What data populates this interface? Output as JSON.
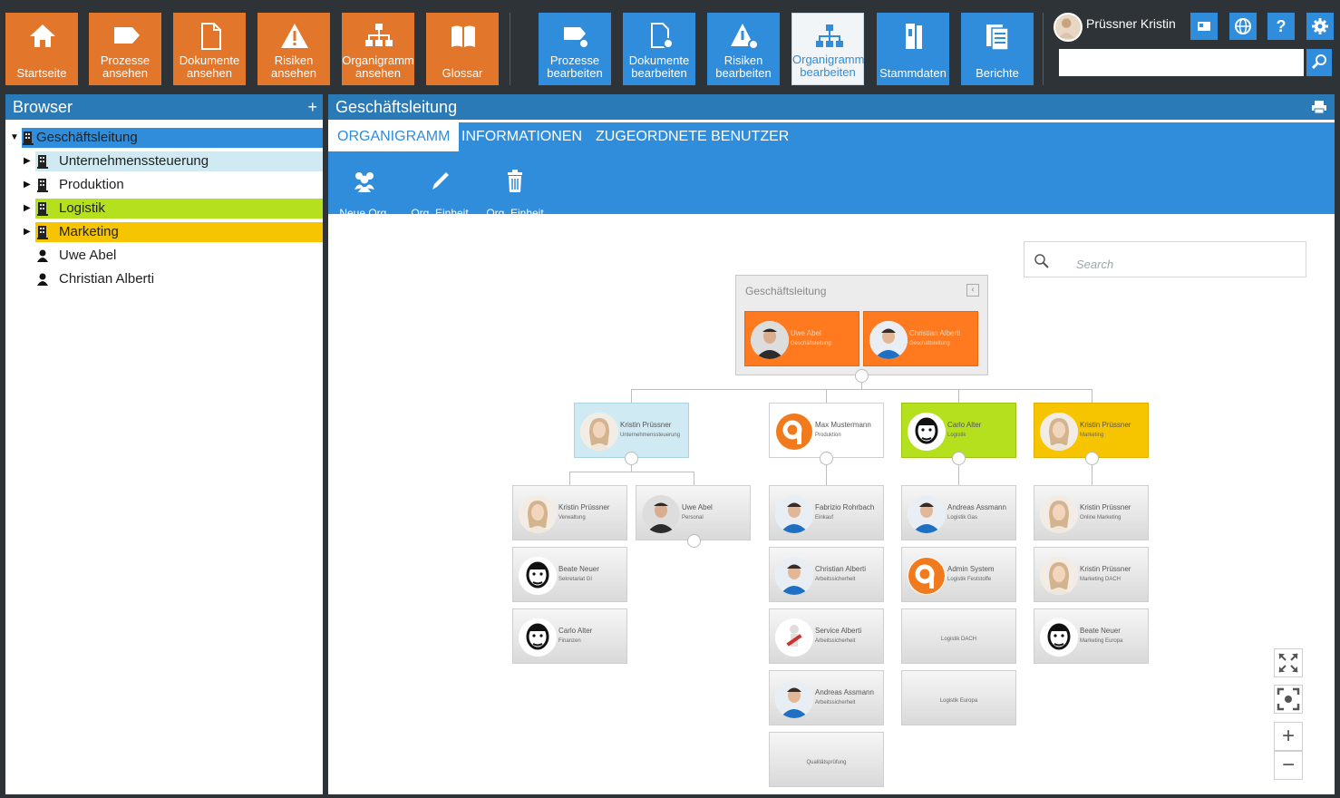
{
  "toolbar": {
    "view_buttons": [
      {
        "label": "Startseite",
        "icon": "home-icon"
      },
      {
        "label": "Prozesse\nansehen",
        "icon": "process-icon"
      },
      {
        "label": "Dokumente\nansehen",
        "icon": "document-icon"
      },
      {
        "label": "Risiken\nansehen",
        "icon": "warning-icon"
      },
      {
        "label": "Organigramm\nansehen",
        "icon": "orgchart-icon"
      },
      {
        "label": "Glossar",
        "icon": "book-icon"
      }
    ],
    "edit_buttons": [
      {
        "label": "Prozesse\nbearbeiten",
        "icon": "process-gear-icon"
      },
      {
        "label": "Dokumente\nbearbeiten",
        "icon": "document-gear-icon"
      },
      {
        "label": "Risiken\nbearbeiten",
        "icon": "warning-gear-icon"
      },
      {
        "label": "Organigramm\nbearbeiten",
        "icon": "orgchart-icon"
      },
      {
        "label": "Stammdaten",
        "icon": "binder-icon"
      },
      {
        "label": "Berichte",
        "icon": "reports-icon"
      }
    ],
    "user_name": "Prüssner Kristin",
    "help_label": "?",
    "search_value": ""
  },
  "browser": {
    "title": "Browser",
    "add_label": "+",
    "items": [
      {
        "label": "Geschäftsleitung",
        "type": "unit",
        "color": "#2f8ddb"
      },
      {
        "label": "Unternehmenssteuerung",
        "type": "unit",
        "color": "#cfeaf3"
      },
      {
        "label": "Produktion",
        "type": "unit",
        "color": "#ffffff"
      },
      {
        "label": "Logistik",
        "type": "unit",
        "color": "#b5e01e"
      },
      {
        "label": "Marketing",
        "type": "unit",
        "color": "#f7c500"
      },
      {
        "label": "Uwe Abel",
        "type": "person"
      },
      {
        "label": "Christian Alberti",
        "type": "person"
      }
    ]
  },
  "main": {
    "title": "Geschäftsleitung",
    "tabs": [
      "ORGANIGRAMM",
      "INFORMATIONEN",
      "ZUGEORDNETE BENUTZER"
    ],
    "actions": [
      {
        "label": "Neue Org.\nEinheit",
        "icon": "group-add-icon"
      },
      {
        "label": "Org. Einheit\nbearbeiten",
        "icon": "pencil-icon"
      },
      {
        "label": "Org. Einheit\nlöschen",
        "icon": "trash-icon"
      }
    ],
    "search_placeholder": "Search"
  },
  "org": {
    "root_title": "Geschäftsleitung",
    "root_members": [
      {
        "name": "Uwe Abel",
        "role": "Geschäftsleitung"
      },
      {
        "name": "Christian Alberti",
        "role": "Geschäftsleitung"
      }
    ],
    "columns": [
      {
        "name": "Kristin Prüssner",
        "role": "Unternehmenssteuerung",
        "color": "#cfeaf3"
      },
      {
        "name": "Max Mustermann",
        "role": "Produktion",
        "color": "#ffffff"
      },
      {
        "name": "Carlo Alter",
        "role": "Logistik",
        "color": "#b5e01e"
      },
      {
        "name": "Kristin Prüssner",
        "role": "Marketing",
        "color": "#f7c500"
      }
    ],
    "col1_a": [
      {
        "name": "Kristin Prüssner",
        "role": "Verwaltung"
      },
      {
        "name": "Beate Neuer",
        "role": "Sekretariat GI"
      },
      {
        "name": "Carlo Alter",
        "role": "Finanzen"
      }
    ],
    "col1_b": [
      {
        "name": "Uwe Abel",
        "role": "Personal"
      }
    ],
    "col2": [
      {
        "name": "Fabrizio Rohrbach",
        "role": "Einkauf"
      },
      {
        "name": "Christian Alberti",
        "role": "Arbeitssicherheit"
      },
      {
        "name": "Service Alberti",
        "role": "Arbeitssicherheit"
      },
      {
        "name": "Andreas Assmann",
        "role": "Arbeitssicherheit"
      },
      {
        "name": "",
        "role": "Qualitätsprüfung"
      }
    ],
    "col3": [
      {
        "name": "Andreas Assmann",
        "role": "Logistik Gas"
      },
      {
        "name": "Admin System",
        "role": "Logistik Feststoffe"
      },
      {
        "name": "",
        "role": "Logistik DACH"
      },
      {
        "name": "",
        "role": "Logistik Europa"
      }
    ],
    "col4": [
      {
        "name": "Kristin Prüssner",
        "role": "Online Marketing"
      },
      {
        "name": "Kristin Prüssner",
        "role": "Marketing DACH"
      },
      {
        "name": "Beate Neuer",
        "role": "Marketing Europa"
      }
    ]
  },
  "zoom": {
    "plus": "+",
    "minus": "−"
  }
}
